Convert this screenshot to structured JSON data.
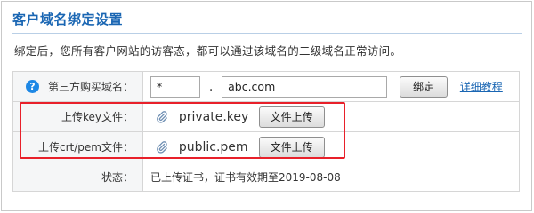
{
  "title": "客户域名绑定设置",
  "description": "绑定后，您所有客户网站的访客态，都可以通过该域名的二级域名正常访问。",
  "domain_row": {
    "label": "第三方购买域名：",
    "subdomain_value": "*",
    "separator": ".",
    "domain_value": "abc.com",
    "bind_button": "绑定",
    "tutorial_link": "详细教程"
  },
  "key_row": {
    "label": "上传key文件：",
    "file_name": "private.key",
    "upload_button": "文件上传"
  },
  "cert_row": {
    "label": "上传crt/pem文件：",
    "file_name": "public.pem",
    "upload_button": "文件上传"
  },
  "status_row": {
    "label": "状态：",
    "text": "已上传证书，证书有效期至2019-08-08"
  },
  "colors": {
    "title": "#1a66b3",
    "highlight": "#e8202a",
    "help_icon": "#1e88e5"
  }
}
